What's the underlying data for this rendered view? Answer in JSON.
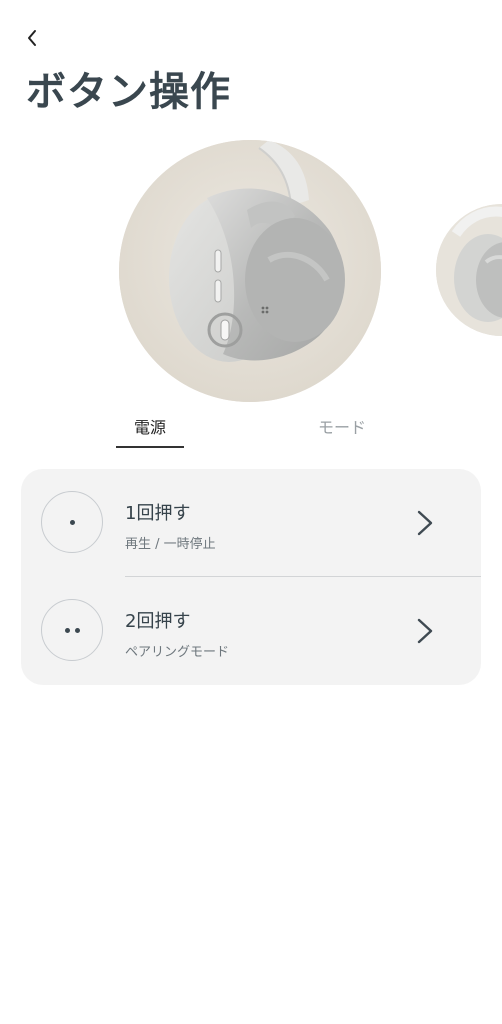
{
  "header": {
    "title": "ボタン操作"
  },
  "tabs": [
    {
      "label": "電源",
      "selected": true
    },
    {
      "label": "モード",
      "selected": false
    }
  ],
  "actions": [
    {
      "title": "1回押す",
      "subtitle": "再生 / 一時停止",
      "icon": "single-dot-icon"
    },
    {
      "title": "2回押す",
      "subtitle": "ペアリングモード",
      "icon": "double-dot-icon"
    }
  ],
  "colors": {
    "title": "#3a474f",
    "card_bg": "#f3f3f3",
    "image_bg": "#e6e1d8"
  }
}
